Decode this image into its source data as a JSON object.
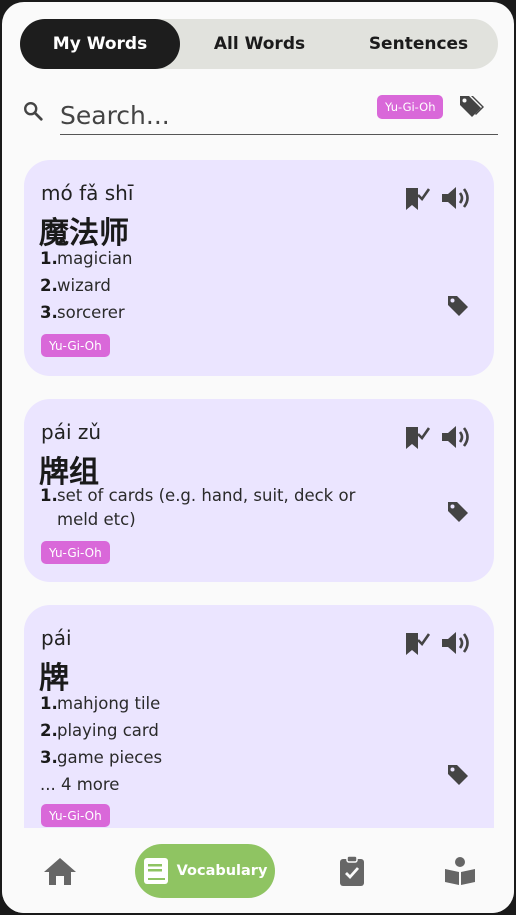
{
  "tabs": [
    {
      "label": "My Words",
      "active": true
    },
    {
      "label": "All Words",
      "active": false
    },
    {
      "label": "Sentences",
      "active": false
    }
  ],
  "search": {
    "placeholder": "Search...",
    "value": "",
    "filter_tag": "Yu-Gi-Oh",
    "search_icon": "search-icon",
    "tag_icon": "tags-icon"
  },
  "cards": [
    {
      "pinyin": "mó fǎ shī",
      "hanzi": "魔法师",
      "definitions": [
        {
          "num": "1.",
          "text": "magician"
        },
        {
          "num": "2.",
          "text": "wizard"
        },
        {
          "num": "3.",
          "text": "sorcerer"
        }
      ],
      "more": "",
      "tag": "Yu-Gi-Oh"
    },
    {
      "pinyin": "pái zǔ",
      "hanzi": "牌组",
      "definitions": [
        {
          "num": "1.",
          "text": "set of cards (e.g. hand, suit, deck or meld etc)"
        }
      ],
      "more": "",
      "tag": "Yu-Gi-Oh"
    },
    {
      "pinyin": "pái",
      "hanzi": "牌",
      "definitions": [
        {
          "num": "1.",
          "text": "mahjong tile"
        },
        {
          "num": "2.",
          "text": "playing card"
        },
        {
          "num": "3.",
          "text": "game pieces"
        }
      ],
      "more": "... 4 more",
      "tag": "Yu-Gi-Oh"
    }
  ],
  "bottom_nav": {
    "items": [
      {
        "icon": "home-icon",
        "label": ""
      },
      {
        "icon": "book-icon",
        "label": "Vocabulary",
        "active": true
      },
      {
        "icon": "clipboard-check-icon",
        "label": ""
      },
      {
        "icon": "reader-icon",
        "label": ""
      }
    ]
  },
  "colors": {
    "tab_active": "#1d1d1d",
    "tab_bg": "#e1e2dd",
    "card_bg": "#ebe5ff",
    "tag_badge": "#d968d9",
    "nav_active": "#8fc462"
  }
}
